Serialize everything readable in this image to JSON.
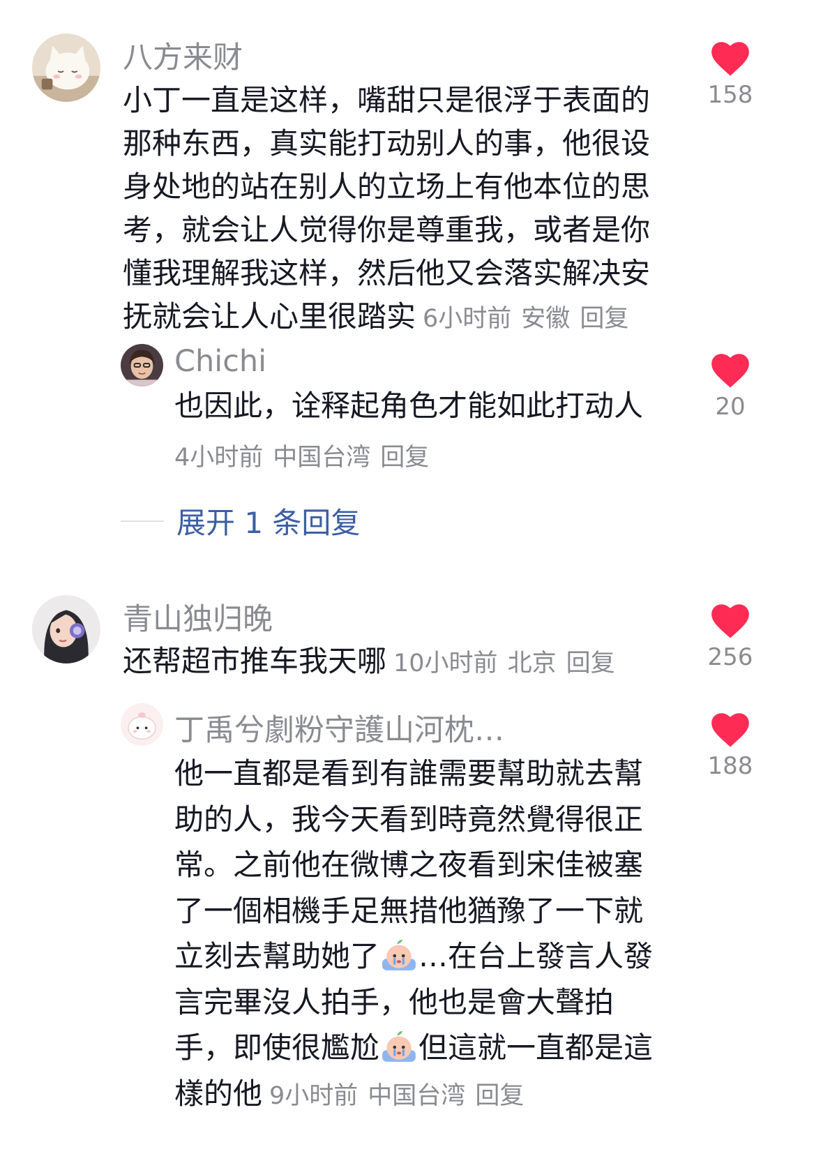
{
  "comments": [
    {
      "username": "八方来财",
      "text": "小丁一直是这样，嘴甜只是很浮于表面的那种东西，真实能打动别人的事，他很设身处地的站在别人的立场上有他本位的思考，就会让人觉得你是尊重我，或者是你懂我理解我这样，然后他又会落实解决安抚就会让人心里很踏实",
      "time": "6小时前",
      "location": "安徽",
      "reply_label": "回复",
      "likes": "158",
      "reply": {
        "username": "Chichi",
        "text": "也因此，诠释起角色才能如此打动人",
        "time": "4小时前",
        "location": "中国台湾",
        "reply_label": "回复",
        "likes": "20"
      },
      "expand_label": "展开 1 条回复"
    },
    {
      "username": "青山独归晚",
      "text": "还帮超市推车我天哪",
      "time": "10小时前",
      "location": "北京",
      "reply_label": "回复",
      "likes": "256",
      "reply": {
        "username": "丁禹兮劇粉守護山河枕…",
        "text_part1": "他一直都是看到有誰需要幫助就去幫助的人，我今天看到時竟然覺得很正常。之前他在微博之夜看到宋佳被塞了一個相機手足無措他猶豫了一下就立刻去幫助她了",
        "text_part2": "…在台上發言人發言完畢沒人拍手，他也是會大聲拍手，即使很尷尬",
        "text_part3": "但這就一直都是這樣的他",
        "emoji_icon": "crying-peach-emoji",
        "time": "9小时前",
        "location": "中国台湾",
        "reply_label": "回复",
        "likes": "188"
      }
    }
  ],
  "colors": {
    "like_red": "#fe2c55",
    "meta_gray": "#8a8b91",
    "link_blue": "#3c5ea4",
    "text_dark": "#161823"
  }
}
